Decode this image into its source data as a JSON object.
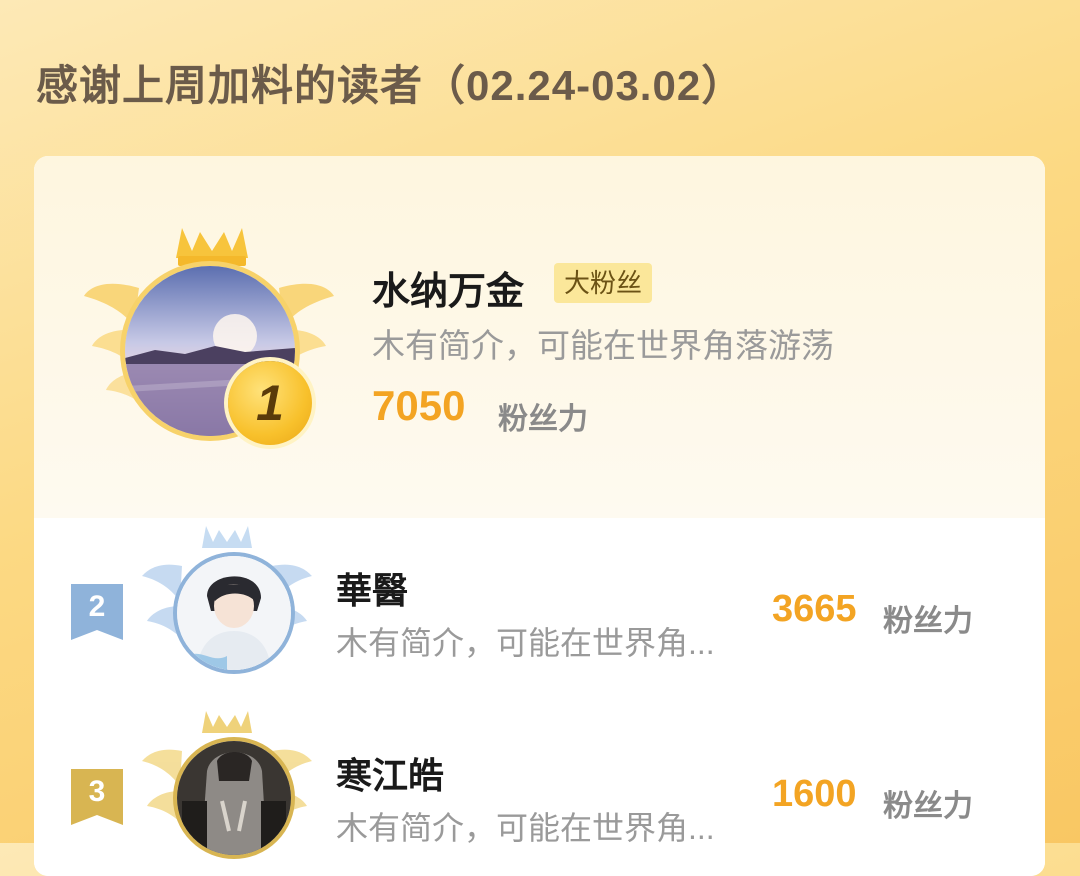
{
  "header": {
    "title": "感谢上周加料的读者（02.24-03.02）"
  },
  "first": {
    "rank": "1",
    "name": "水纳万金",
    "badge": "大粉丝",
    "bio": "木有简介，可能在世界角落游荡",
    "score": "7050",
    "unit": "粉丝力",
    "avatar": "sunset-sea-avatar",
    "crown": "crown-icon"
  },
  "others": [
    {
      "rank": "2",
      "name": "華醫",
      "bio": "木有简介，可能在世界角...",
      "score": "3665",
      "unit": "粉丝力",
      "avatar": "anime-boy-avatar",
      "accent": "#8fb3da"
    },
    {
      "rank": "3",
      "name": "寒江皓",
      "bio": "木有简介，可能在世界角...",
      "score": "1600",
      "unit": "粉丝力",
      "avatar": "hoodie-person-avatar",
      "accent": "#d8b552"
    }
  ],
  "colors": {
    "score": "#f3a423",
    "gold": "#f8c12c",
    "silver": "#8fb3da",
    "bronze": "#d8b552"
  }
}
